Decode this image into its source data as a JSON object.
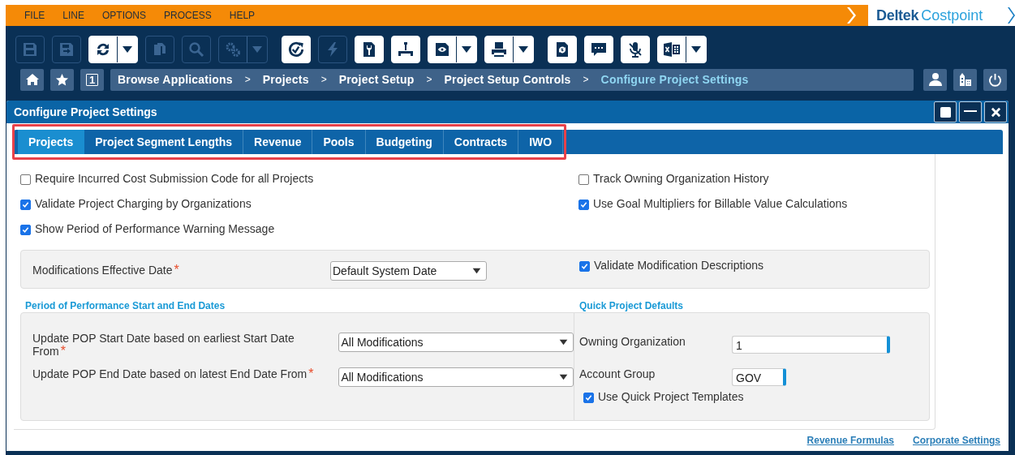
{
  "menu": [
    "FILE",
    "LINE",
    "OPTIONS",
    "PROCESS",
    "HELP"
  ],
  "logo": {
    "brand": "Deltek",
    "product": "Costpoint"
  },
  "toolbar": [
    {
      "disabled": true,
      "dropdown": false
    },
    {
      "disabled": true,
      "dropdown": false
    },
    {
      "disabled": false,
      "dropdown": true
    },
    {
      "disabled": true,
      "dropdown": false
    },
    {
      "disabled": true,
      "dropdown": false
    },
    {
      "disabled": true,
      "dropdown": true
    },
    {
      "disabled": false,
      "dropdown": false
    },
    {
      "disabled": true,
      "dropdown": false
    },
    {
      "disabled": false,
      "dropdown": false
    },
    {
      "disabled": false,
      "dropdown": false
    },
    {
      "disabled": false,
      "dropdown": true
    },
    {
      "disabled": false,
      "dropdown": true
    },
    {
      "disabled": false,
      "dropdown": false
    },
    {
      "disabled": false,
      "dropdown": false
    },
    {
      "disabled": false,
      "dropdown": false
    },
    {
      "disabled": false,
      "dropdown": true
    }
  ],
  "nav": {
    "window_count": "1",
    "breadcrumbs": [
      {
        "label": "Browse Applications",
        "current": false
      },
      {
        "label": "Projects",
        "current": false
      },
      {
        "label": "Project Setup",
        "current": false
      },
      {
        "label": "Project Setup Controls",
        "current": false
      },
      {
        "label": "Configure Project Settings",
        "current": true
      }
    ],
    "separators": [
      ">",
      ">",
      ">",
      ">"
    ]
  },
  "window": {
    "title": "Configure Project Settings"
  },
  "tabs": [
    {
      "label": "Projects",
      "selected": true
    },
    {
      "label": "Project Segment Lengths",
      "selected": false
    },
    {
      "label": "Revenue",
      "selected": false
    },
    {
      "label": "Pools",
      "selected": false
    },
    {
      "label": "Budgeting",
      "selected": false
    },
    {
      "label": "Contracts",
      "selected": false
    },
    {
      "label": "IWO",
      "selected": false
    }
  ],
  "options_left": [
    {
      "label": "Require Incurred Cost Submission Code for all Projects",
      "checked": false
    },
    {
      "label": "Validate Project Charging by Organizations",
      "checked": true
    },
    {
      "label": "Show Period of Performance Warning Message",
      "checked": true
    }
  ],
  "options_right": [
    {
      "label": "Track Owning Organization History",
      "checked": false
    },
    {
      "label": "Use Goal Multipliers for Billable Value Calculations",
      "checked": true
    }
  ],
  "modifications": {
    "label": "Modifications Effective Date",
    "required_mark": "*",
    "value": "Default System Date",
    "option": {
      "label": "Validate Modification Descriptions",
      "checked": true
    }
  },
  "pop_dates": {
    "legend": "Period of Performance Start and End Dates",
    "fields": [
      {
        "label": "Update POP Start Date based on earliest Start Date From",
        "required_mark": "*",
        "value": "All Modifications"
      },
      {
        "label": "Update POP End Date based on latest End Date From",
        "required_mark": "*",
        "value": "All Modifications"
      }
    ]
  },
  "quick_defaults": {
    "legend": "Quick Project Defaults",
    "fields": [
      {
        "label": "Owning Organization",
        "value": "1"
      },
      {
        "label": "Account Group",
        "value": "GOV"
      }
    ],
    "option": {
      "label": "Use Quick Project Templates",
      "checked": true
    }
  },
  "links": [
    "Revenue Formulas",
    "Corporate Settings"
  ]
}
